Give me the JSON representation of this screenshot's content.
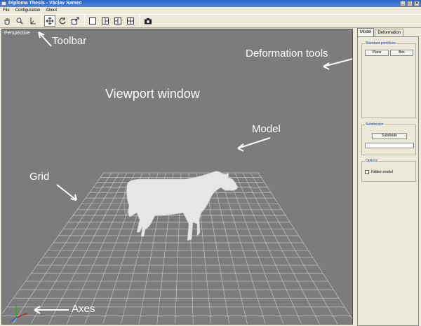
{
  "window": {
    "title": "Diploma Thesis - Václav Samec",
    "buttons": [
      "_",
      "□",
      "×"
    ]
  },
  "menu": [
    "File",
    "Configuration",
    "About"
  ],
  "toolbar": {
    "groups": [
      [
        "hand-icon",
        "zoom-icon",
        "axis-tool-icon"
      ],
      [
        "move-icon",
        "rotate-icon",
        "scale-icon"
      ],
      [
        "single-view-icon",
        "split-view-3a-icon",
        "split-view-3b-icon",
        "quad-view-icon"
      ],
      [
        "camera-icon"
      ]
    ]
  },
  "viewport": {
    "label": "Perspective",
    "background": "#7c7c7c"
  },
  "annotations": {
    "toolbar": "Toolbar",
    "deformation_tools": "Deformation tools",
    "viewport_window": "Viewport window",
    "model": "Model",
    "grid": "Grid",
    "axes": "Axes"
  },
  "panel": {
    "tabs": [
      "Model",
      "Deformation"
    ],
    "standard_primitives": {
      "title": "Standard primitives",
      "buttons": [
        "Plane",
        "Box"
      ]
    },
    "subdivision": {
      "title": "Subdivision",
      "button": "Subdivide",
      "progress": 0
    },
    "options": {
      "title": "Options",
      "hidden_model_label": "Hidden model",
      "hidden_model_checked": false
    }
  }
}
